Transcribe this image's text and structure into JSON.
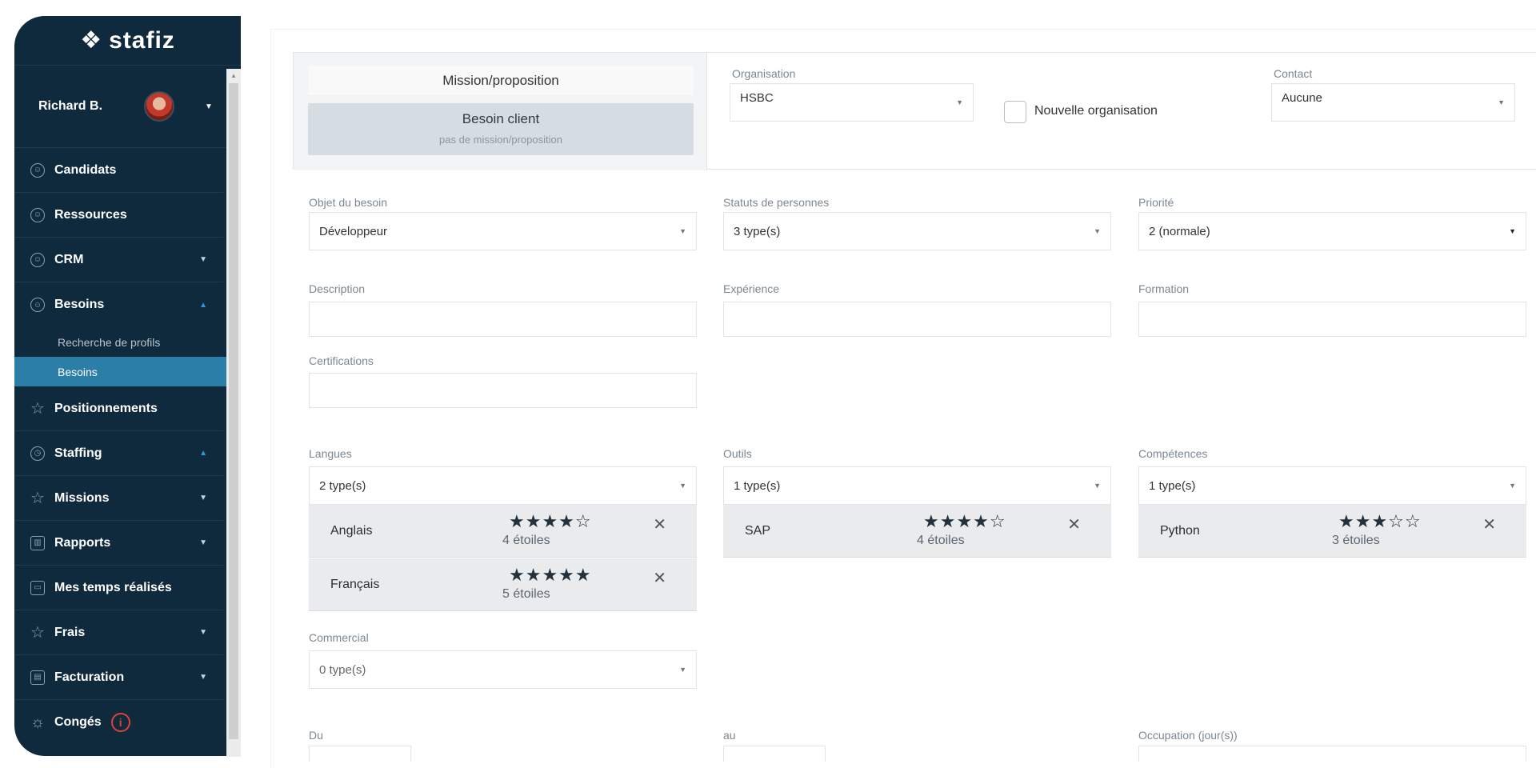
{
  "brand": {
    "name": "stafiz",
    "mark": "❖"
  },
  "user": {
    "name": "Richard B."
  },
  "nav": {
    "candidats": "Candidats",
    "ressources": "Ressources",
    "crm": "CRM",
    "besoins": "Besoins",
    "sub_recherche": "Recherche de profils",
    "sub_besoins": "Besoins",
    "positionnements": "Positionnements",
    "staffing": "Staffing",
    "missions": "Missions",
    "rapports": "Rapports",
    "temps": "Mes temps réalisés",
    "frais": "Frais",
    "facturation": "Facturation",
    "conges": "Congés"
  },
  "mission": {
    "header": "Mission/proposition",
    "choice_title": "Besoin client",
    "choice_sub": "pas de mission/proposition"
  },
  "org": {
    "label": "Organisation",
    "value": "HSBC",
    "new_label": "Nouvelle organisation",
    "contact_label": "Contact",
    "contact_value": "Aucune"
  },
  "form": {
    "objet_label": "Objet du besoin",
    "objet_value": "Développeur",
    "statuts_label": "Statuts de personnes",
    "statuts_value": "3 type(s)",
    "priorite_label": "Priorité",
    "priorite_value": "2 (normale)",
    "description_label": "Description",
    "experience_label": "Expérience",
    "formation_label": "Formation",
    "certifications_label": "Certifications",
    "langues_label": "Langues",
    "langues_value": "2 type(s)",
    "outils_label": "Outils",
    "outils_value": "1 type(s)",
    "competences_label": "Compétences",
    "competences_value": "1 type(s)",
    "commercial_label": "Commercial",
    "commercial_value": "0 type(s)",
    "du_label": "Du",
    "au_label": "au",
    "occupation_label": "Occupation (jour(s))"
  },
  "langues": [
    {
      "name": "Anglais",
      "stars": "★★★★☆",
      "rating": "4 étoiles"
    },
    {
      "name": "Français",
      "stars": "★★★★★",
      "rating": "5 étoiles"
    }
  ],
  "outils": [
    {
      "name": "SAP",
      "stars": "★★★★☆",
      "rating": "4 étoiles"
    }
  ],
  "competences": [
    {
      "name": "Python",
      "stars": "★★★☆☆",
      "rating": "3 étoiles"
    }
  ],
  "colors": {
    "sidebar": "#0f2a3d",
    "active": "#2b7ea8",
    "alert": "#e0403a"
  }
}
